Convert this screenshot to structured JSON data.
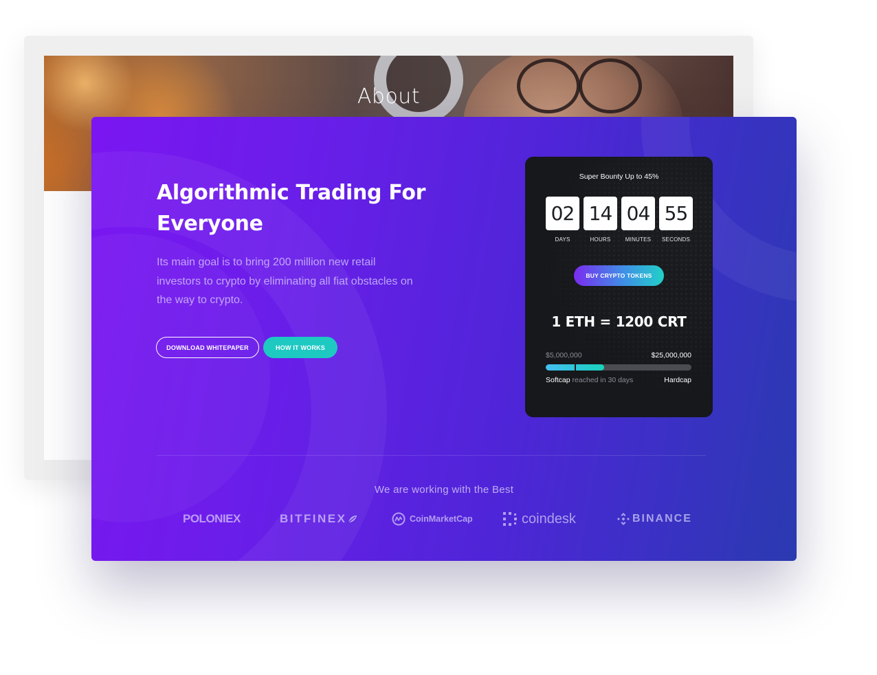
{
  "back_window": {
    "hero_title": "About"
  },
  "hero": {
    "headline": "Algorithmic Trading For Everyone",
    "lead": "Its main goal is to bring 200 million new retail investors to crypto by eliminating all fiat obstacles on the way to crypto.",
    "download_label": "DOWNLOAD WHITEPAPER",
    "how_label": "HOW IT WORKS"
  },
  "sale_widget": {
    "title": "Super Bounty Up to 45%",
    "countdown": [
      {
        "value": "02",
        "label": "DAYS"
      },
      {
        "value": "14",
        "label": "HOURS"
      },
      {
        "value": "04",
        "label": "MINUTES"
      },
      {
        "value": "55",
        "label": "SECONDS"
      }
    ],
    "buy_label": "BUY CRYPTO TOKENS",
    "rate": "1 ETH = 1200 CRT",
    "min_amount": "$5,000,000",
    "max_amount": "$25,000,000",
    "progress_fraction": 0.4,
    "softcap_fraction": 0.2,
    "softcap_label": "Softcap",
    "softcap_note": "reached in 30 days",
    "hardcap_label": "Hardcap"
  },
  "partners": {
    "title": "We are working with the Best",
    "logos": [
      {
        "name": "POLONIEX",
        "icon": "poloniex-logo"
      },
      {
        "name": "BITFINEX",
        "icon": "bitfinex-leaf-icon"
      },
      {
        "name": "CoinMarketCap",
        "icon": "coinmarketcap-icon"
      },
      {
        "name": "coindesk",
        "icon": "coindesk-icon"
      },
      {
        "name": "BINANCE",
        "icon": "binance-icon"
      }
    ]
  },
  "colors": {
    "card_gradient_start": "#7b16f2",
    "card_gradient_end": "#2a3ab0",
    "widget_bg": "#1b1d21",
    "accent_teal": "#1ec9c2",
    "progress_start": "#45c0f2",
    "progress_end": "#19d3ba"
  }
}
